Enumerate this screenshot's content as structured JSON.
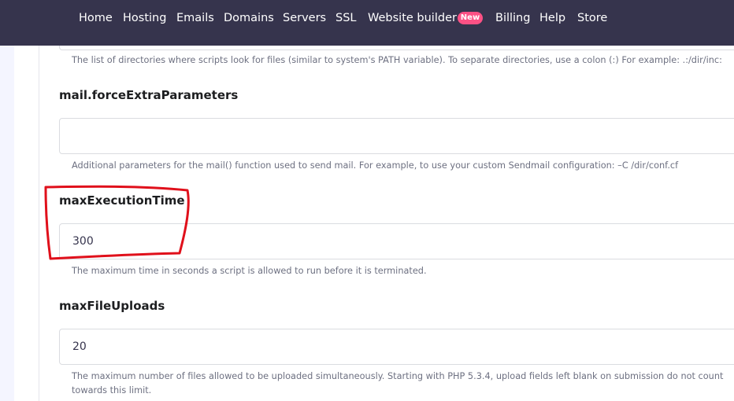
{
  "nav": {
    "items": [
      "Home",
      "Hosting",
      "Emails",
      "Domains",
      "Servers",
      "SSL",
      "Website builder",
      "Billing",
      "Help",
      "Store"
    ],
    "badge": "New"
  },
  "fields": {
    "include_path": {
      "help": "The list of directories where scripts look for files (similar to system's PATH variable). To separate directories, use a colon (:) For example: .:/dir/inc:"
    },
    "mail_force_extra": {
      "label": "mail.forceExtraParameters",
      "value": "",
      "help": "Additional parameters for the mail() function used to send mail. For example, to use your custom Sendmail configuration: –C /dir/conf.cf"
    },
    "max_execution_time": {
      "label": "maxExecutionTime",
      "value": "300",
      "help": "The maximum time in seconds a script is allowed to run before it is terminated."
    },
    "max_file_uploads": {
      "label": "maxFileUploads",
      "value": "20",
      "help": "The maximum number of files allowed to be uploaded simultaneously. Starting with PHP 5.3.4, upload fields left blank on submission do not count towards this limit."
    }
  },
  "colors": {
    "navbar": "#36344d",
    "badge": "#fc5185",
    "annotation": "#e0101b"
  }
}
